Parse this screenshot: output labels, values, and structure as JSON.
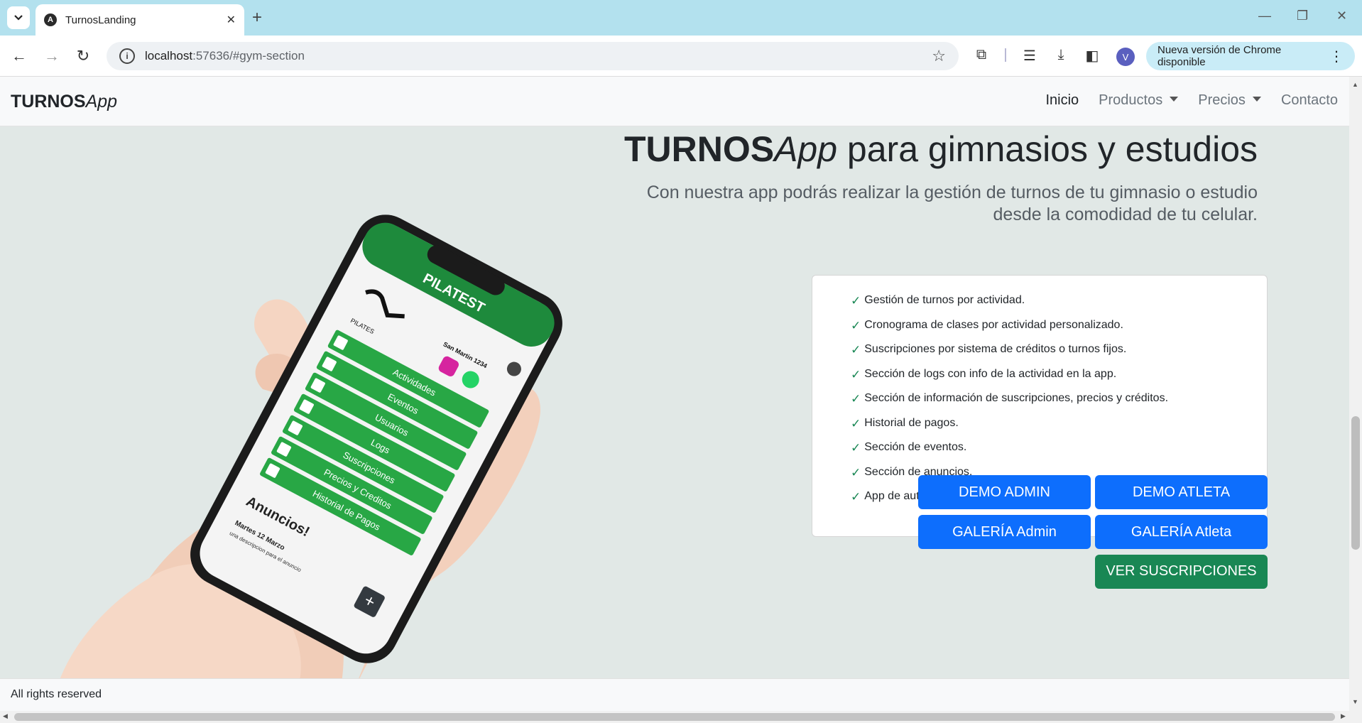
{
  "browser": {
    "tab_title": "TurnosLanding",
    "url_host": "localhost",
    "url_path": ":57636/#gym-section",
    "update_label": "Nueva versión de Chrome disponible",
    "profile_initial": "V"
  },
  "site": {
    "brand_bold": "TURNOS",
    "brand_italic": "App",
    "nav": {
      "inicio": "Inicio",
      "productos": "Productos",
      "precios": "Precios",
      "contacto": "Contacto"
    }
  },
  "hero": {
    "title_bold": "TURNOS",
    "title_italic": "App",
    "title_rest": " para gimnasios y estudios",
    "subtitle": "Con nuestra app podrás realizar la gestión de turnos de tu gimnasio o estudio desde la comodidad de tu celular."
  },
  "features": [
    "Gestión de turnos por actividad.",
    "Cronograma de clases por actividad personalizado.",
    "Suscripciones por sistema de créditos o turnos fijos.",
    "Sección de logs con info de la actividad en la app.",
    "Sección de información de suscripciones, precios y créditos.",
    "Historial de pagos.",
    "Sección de eventos.",
    "Sección de anuncios.",
    "App de autogestión de turnos para el atleta."
  ],
  "buttons": {
    "demo_admin": "DEMO ADMIN",
    "demo_atleta": "DEMO ATLETA",
    "galeria_admin": "GALERÍA Admin",
    "galeria_atleta": "GALERÍA Atleta",
    "ver_suscripciones": "VER SUSCRIPCIONES"
  },
  "phone_app": {
    "header": "PILATEST",
    "logo_text": "PILATES",
    "address": "San Martin 1234",
    "menu": [
      "Actividades",
      "Eventos",
      "Usuarios",
      "Logs",
      "Suscripciones",
      "Precios y Creditos",
      "Historial de Pagos"
    ],
    "announcements_title": "Anuncios!",
    "announcement_date": "Martes 12 Marzo",
    "announcement_desc": "una descripcion para el anuncio"
  },
  "footer": {
    "text": "All rights reserved"
  },
  "colors": {
    "primary_button": "#0d6efd",
    "success_button": "#198754",
    "phone_green": "#28a745",
    "page_background": "#e1e8e6"
  }
}
